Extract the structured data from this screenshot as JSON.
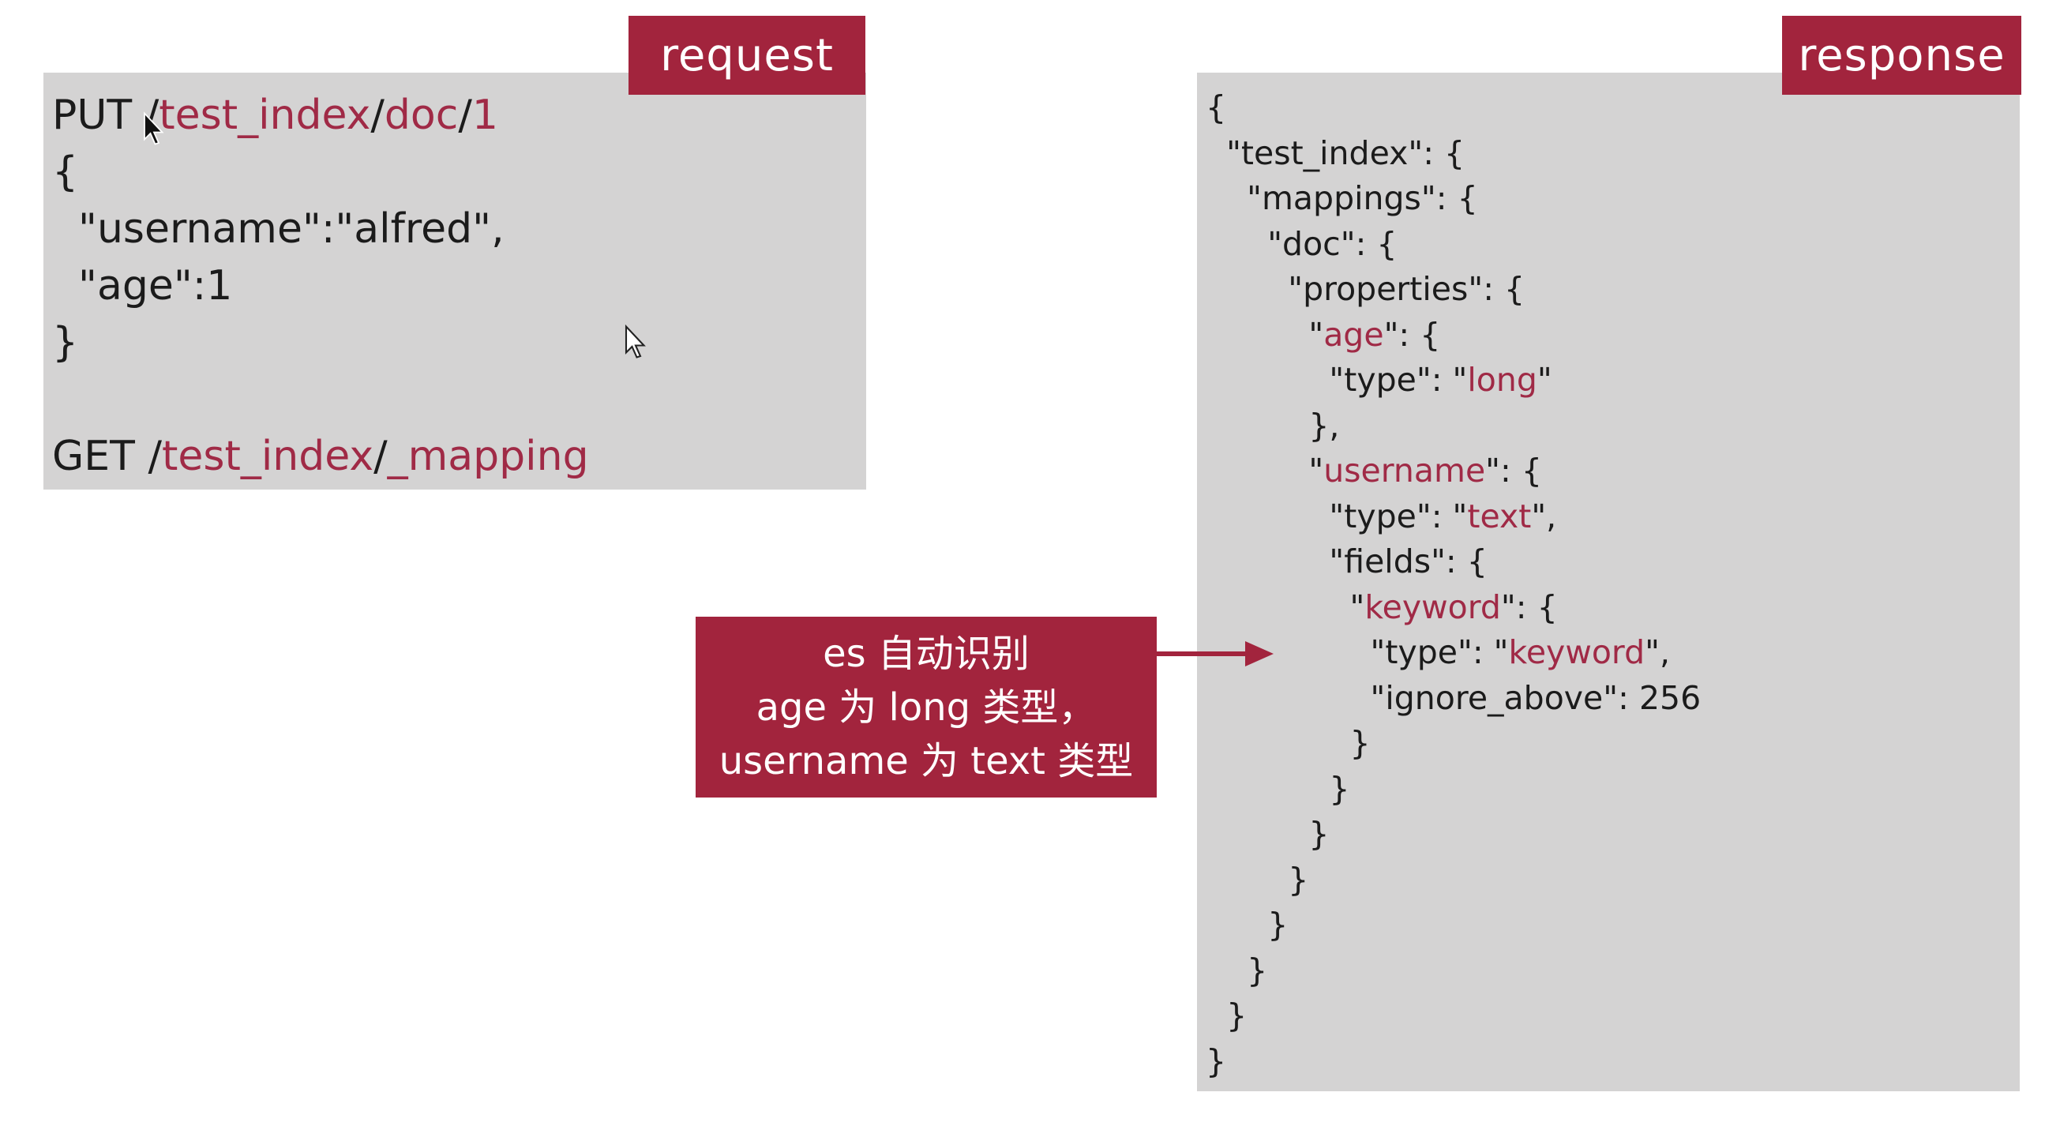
{
  "request": {
    "tag": "request",
    "lines": [
      {
        "parts": [
          {
            "t": "PUT /",
            "hl": false
          },
          {
            "t": "test_index",
            "hl": true
          },
          {
            "t": "/",
            "hl": false
          },
          {
            "t": "doc",
            "hl": true
          },
          {
            "t": "/",
            "hl": false
          },
          {
            "t": "1",
            "hl": true
          }
        ]
      },
      {
        "parts": [
          {
            "t": "{",
            "hl": false
          }
        ]
      },
      {
        "parts": [
          {
            "t": "  \"username\":\"alfred\",",
            "hl": false
          }
        ]
      },
      {
        "parts": [
          {
            "t": "  \"age\":1",
            "hl": false
          }
        ]
      },
      {
        "parts": [
          {
            "t": "}",
            "hl": false
          }
        ]
      },
      {
        "parts": [
          {
            "t": "",
            "hl": false
          }
        ]
      },
      {
        "parts": [
          {
            "t": "GET /",
            "hl": false
          },
          {
            "t": "test_index",
            "hl": true
          },
          {
            "t": "/",
            "hl": false
          },
          {
            "t": "_mapping",
            "hl": true
          }
        ]
      }
    ]
  },
  "response": {
    "tag": "response",
    "lines": [
      {
        "parts": [
          {
            "t": "{",
            "hl": false
          }
        ]
      },
      {
        "parts": [
          {
            "t": "  \"test_index\": {",
            "hl": false
          }
        ]
      },
      {
        "parts": [
          {
            "t": "    \"mappings\": {",
            "hl": false
          }
        ]
      },
      {
        "parts": [
          {
            "t": "      \"doc\": {",
            "hl": false
          }
        ]
      },
      {
        "parts": [
          {
            "t": "        \"properties\": {",
            "hl": false
          }
        ]
      },
      {
        "parts": [
          {
            "t": "          \"",
            "hl": false
          },
          {
            "t": "age",
            "hl": true
          },
          {
            "t": "\": {",
            "hl": false
          }
        ]
      },
      {
        "parts": [
          {
            "t": "            \"type\": \"",
            "hl": false
          },
          {
            "t": "long",
            "hl": true
          },
          {
            "t": "\"",
            "hl": false
          }
        ]
      },
      {
        "parts": [
          {
            "t": "          },",
            "hl": false
          }
        ]
      },
      {
        "parts": [
          {
            "t": "          \"",
            "hl": false
          },
          {
            "t": "username",
            "hl": true
          },
          {
            "t": "\": {",
            "hl": false
          }
        ]
      },
      {
        "parts": [
          {
            "t": "            \"type\": \"",
            "hl": false
          },
          {
            "t": "text",
            "hl": true
          },
          {
            "t": "\",",
            "hl": false
          }
        ]
      },
      {
        "parts": [
          {
            "t": "            \"fields\": {",
            "hl": false
          }
        ]
      },
      {
        "parts": [
          {
            "t": "              \"",
            "hl": false
          },
          {
            "t": "keyword",
            "hl": true
          },
          {
            "t": "\": {",
            "hl": false
          }
        ]
      },
      {
        "parts": [
          {
            "t": "                \"type\": \"",
            "hl": false
          },
          {
            "t": "keyword",
            "hl": true
          },
          {
            "t": "\",",
            "hl": false
          }
        ]
      },
      {
        "parts": [
          {
            "t": "                \"ignore_above\": 256",
            "hl": false
          }
        ]
      },
      {
        "parts": [
          {
            "t": "              }",
            "hl": false
          }
        ]
      },
      {
        "parts": [
          {
            "t": "            }",
            "hl": false
          }
        ]
      },
      {
        "parts": [
          {
            "t": "          }",
            "hl": false
          }
        ]
      },
      {
        "parts": [
          {
            "t": "        }",
            "hl": false
          }
        ]
      },
      {
        "parts": [
          {
            "t": "      }",
            "hl": false
          }
        ]
      },
      {
        "parts": [
          {
            "t": "    }",
            "hl": false
          }
        ]
      },
      {
        "parts": [
          {
            "t": "  }",
            "hl": false
          }
        ]
      },
      {
        "parts": [
          {
            "t": "}",
            "hl": false
          }
        ]
      }
    ]
  },
  "annotation": {
    "line1": "es 自动识别",
    "line2": "age 为 long 类型，",
    "line3": "username 为 text 类型"
  },
  "colors": {
    "accent": "#a2243d",
    "highlight_text": "#a02a46",
    "panel_bg": "#d4d3d3",
    "text": "#1b1b1b"
  },
  "icons": [
    "mouse-cursor-icon",
    "mouse-cursor-icon",
    "right-arrow-icon"
  ]
}
